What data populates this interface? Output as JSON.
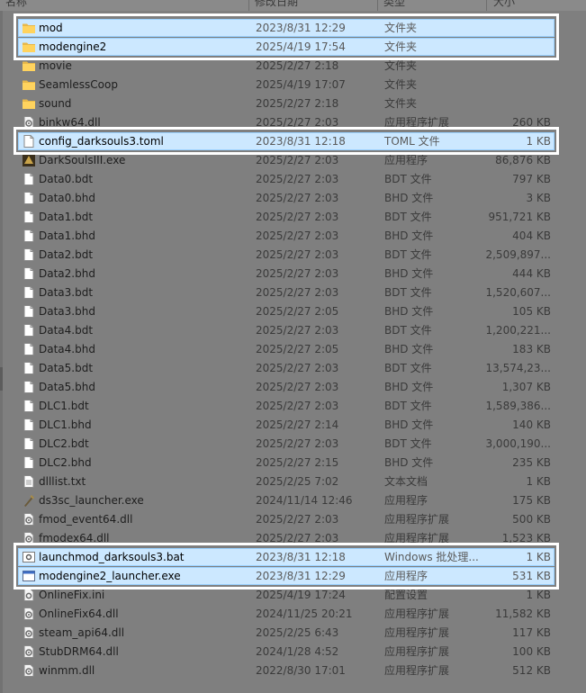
{
  "columns": {
    "name": "名称",
    "date": "修改日期",
    "type": "类型",
    "size": "大小"
  },
  "files": [
    {
      "name": "mod",
      "date": "2023/8/31 12:29",
      "type": "文件夹",
      "size": "",
      "icon": "folder-icon",
      "selected": true
    },
    {
      "name": "modengine2",
      "date": "2025/4/19 17:54",
      "type": "文件夹",
      "size": "",
      "icon": "folder-icon",
      "selected": true
    },
    {
      "name": "movie",
      "date": "2025/2/27 2:18",
      "type": "文件夹",
      "size": "",
      "icon": "folder-icon",
      "selected": false
    },
    {
      "name": "SeamlessCoop",
      "date": "2025/4/19 17:07",
      "type": "文件夹",
      "size": "",
      "icon": "folder-icon",
      "selected": false
    },
    {
      "name": "sound",
      "date": "2025/2/27 2:18",
      "type": "文件夹",
      "size": "",
      "icon": "folder-icon",
      "selected": false
    },
    {
      "name": "binkw64.dll",
      "date": "2025/2/27 2:03",
      "type": "应用程序扩展",
      "size": "260 KB",
      "icon": "dll-icon",
      "selected": false
    },
    {
      "name": "config_darksouls3.toml",
      "date": "2023/8/31 12:18",
      "type": "TOML 文件",
      "size": "1 KB",
      "icon": "document-icon",
      "selected": true
    },
    {
      "name": "DarkSoulsIII.exe",
      "date": "2025/2/27 2:03",
      "type": "应用程序",
      "size": "86,876 KB",
      "icon": "game-exe-icon",
      "selected": false
    },
    {
      "name": "Data0.bdt",
      "date": "2025/2/27 2:03",
      "type": "BDT 文件",
      "size": "797 KB",
      "icon": "document-icon",
      "selected": false
    },
    {
      "name": "Data0.bhd",
      "date": "2025/2/27 2:03",
      "type": "BHD 文件",
      "size": "3 KB",
      "icon": "document-icon",
      "selected": false
    },
    {
      "name": "Data1.bdt",
      "date": "2025/2/27 2:03",
      "type": "BDT 文件",
      "size": "951,721 KB",
      "icon": "document-icon",
      "selected": false
    },
    {
      "name": "Data1.bhd",
      "date": "2025/2/27 2:03",
      "type": "BHD 文件",
      "size": "404 KB",
      "icon": "document-icon",
      "selected": false
    },
    {
      "name": "Data2.bdt",
      "date": "2025/2/27 2:03",
      "type": "BDT 文件",
      "size": "2,509,897...",
      "icon": "document-icon",
      "selected": false
    },
    {
      "name": "Data2.bhd",
      "date": "2025/2/27 2:03",
      "type": "BHD 文件",
      "size": "444 KB",
      "icon": "document-icon",
      "selected": false
    },
    {
      "name": "Data3.bdt",
      "date": "2025/2/27 2:03",
      "type": "BDT 文件",
      "size": "1,520,607...",
      "icon": "document-icon",
      "selected": false
    },
    {
      "name": "Data3.bhd",
      "date": "2025/2/27 2:05",
      "type": "BHD 文件",
      "size": "105 KB",
      "icon": "document-icon",
      "selected": false
    },
    {
      "name": "Data4.bdt",
      "date": "2025/2/27 2:03",
      "type": "BDT 文件",
      "size": "1,200,221...",
      "icon": "document-icon",
      "selected": false
    },
    {
      "name": "Data4.bhd",
      "date": "2025/2/27 2:05",
      "type": "BHD 文件",
      "size": "183 KB",
      "icon": "document-icon",
      "selected": false
    },
    {
      "name": "Data5.bdt",
      "date": "2025/2/27 2:03",
      "type": "BDT 文件",
      "size": "13,574,23...",
      "icon": "document-icon",
      "selected": false
    },
    {
      "name": "Data5.bhd",
      "date": "2025/2/27 2:03",
      "type": "BHD 文件",
      "size": "1,307 KB",
      "icon": "document-icon",
      "selected": false
    },
    {
      "name": "DLC1.bdt",
      "date": "2025/2/27 2:03",
      "type": "BDT 文件",
      "size": "1,589,386...",
      "icon": "document-icon",
      "selected": false
    },
    {
      "name": "DLC1.bhd",
      "date": "2025/2/27 2:14",
      "type": "BHD 文件",
      "size": "140 KB",
      "icon": "document-icon",
      "selected": false
    },
    {
      "name": "DLC2.bdt",
      "date": "2025/2/27 2:03",
      "type": "BDT 文件",
      "size": "3,000,190...",
      "icon": "document-icon",
      "selected": false
    },
    {
      "name": "DLC2.bhd",
      "date": "2025/2/27 2:15",
      "type": "BHD 文件",
      "size": "235 KB",
      "icon": "document-icon",
      "selected": false
    },
    {
      "name": "dlllist.txt",
      "date": "2025/2/25 7:02",
      "type": "文本文档",
      "size": "1 KB",
      "icon": "text-file-icon",
      "selected": false
    },
    {
      "name": "ds3sc_launcher.exe",
      "date": "2024/11/14 12:46",
      "type": "应用程序",
      "size": "175 KB",
      "icon": "launcher-exe-icon",
      "selected": false
    },
    {
      "name": "fmod_event64.dll",
      "date": "2025/2/27 2:03",
      "type": "应用程序扩展",
      "size": "500 KB",
      "icon": "dll-icon",
      "selected": false
    },
    {
      "name": "fmodex64.dll",
      "date": "2025/2/27 2:03",
      "type": "应用程序扩展",
      "size": "1,523 KB",
      "icon": "dll-icon",
      "selected": false
    },
    {
      "name": "launchmod_darksouls3.bat",
      "date": "2023/8/31 12:18",
      "type": "Windows 批处理...",
      "size": "1 KB",
      "icon": "batch-file-icon",
      "selected": true
    },
    {
      "name": "modengine2_launcher.exe",
      "date": "2023/8/31 12:29",
      "type": "应用程序",
      "size": "531 KB",
      "icon": "exe-icon",
      "selected": true
    },
    {
      "name": "OnlineFix.ini",
      "date": "2025/4/19 17:24",
      "type": "配置设置",
      "size": "1 KB",
      "icon": "settings-file-icon",
      "selected": false
    },
    {
      "name": "OnlineFix64.dll",
      "date": "2024/11/25 20:21",
      "type": "应用程序扩展",
      "size": "11,582 KB",
      "icon": "dll-icon",
      "selected": false
    },
    {
      "name": "steam_api64.dll",
      "date": "2025/2/25 6:43",
      "type": "应用程序扩展",
      "size": "117 KB",
      "icon": "dll-icon",
      "selected": false
    },
    {
      "name": "StubDRM64.dll",
      "date": "2024/1/28 4:52",
      "type": "应用程序扩展",
      "size": "100 KB",
      "icon": "dll-icon",
      "selected": false
    },
    {
      "name": "winmm.dll",
      "date": "2022/8/30 17:01",
      "type": "应用程序扩展",
      "size": "512 KB",
      "icon": "dll-icon",
      "selected": false
    }
  ]
}
